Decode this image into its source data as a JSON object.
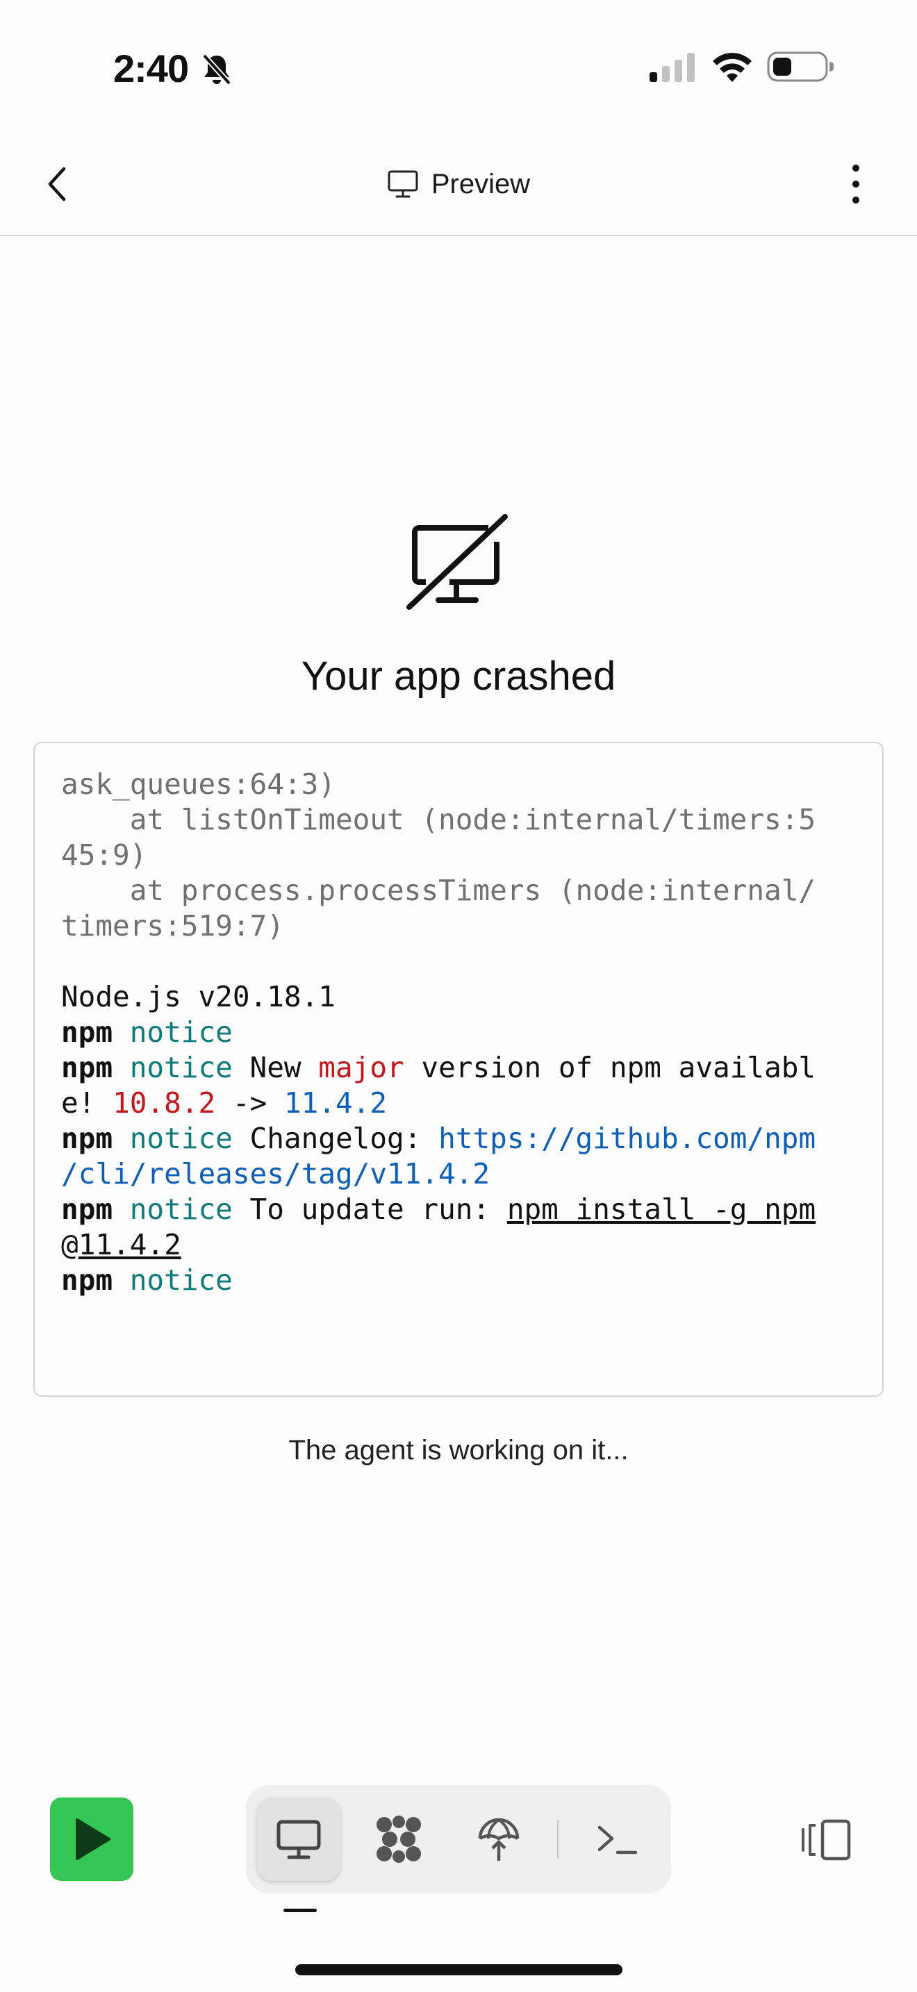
{
  "status_bar": {
    "time": "2:40",
    "icons": [
      "bell-slash-icon",
      "cellular-signal-icon",
      "wifi-icon",
      "battery-icon"
    ]
  },
  "header": {
    "title": "Preview",
    "icons": [
      "back-chevron-icon",
      "monitor-icon",
      "more-vertical-icon"
    ]
  },
  "crash": {
    "icon": "monitor-off-icon",
    "title": "Your app crashed"
  },
  "log": {
    "l1": "ask_queues:64:3)",
    "l2": "    at listOnTimeout (node:internal/timers:5",
    "l3": "45:9)",
    "l4": "    at process.processTimers (node:internal/",
    "l5": "timers:519:7)",
    "node_version": "Node.js v20.18.1",
    "npm": "npm",
    "notice": "notice",
    "new_text": " New ",
    "major": "major",
    "version_text": " version of npm availabl",
    "e_excl": "e! ",
    "old_version": "10.8.2",
    "arrow": " -> ",
    "new_version": "11.4.2",
    "changelog_label": " Changelog: ",
    "changelog_url_1": "https://github.com/npm",
    "changelog_url_2": "/cli/releases/tag/v11.4.2",
    "update_label": " To update run: ",
    "update_cmd_1": "npm install -g npm",
    "update_cmd_2_at": "@",
    "update_cmd_2_ver": "11.4.2"
  },
  "agent_status": "The agent is working on it...",
  "toolbar": {
    "run_icon": "play-icon",
    "tools": [
      "preview-monitor-icon",
      "workflows-icon",
      "deploy-icon",
      "shell-terminal-icon"
    ],
    "panel_icon": "panel-toggle-icon"
  },
  "colors": {
    "run_green": "#33c653",
    "notice_teal": "#0e7a7a",
    "major_red": "#c0181c",
    "link_blue": "#0d5fb5"
  }
}
